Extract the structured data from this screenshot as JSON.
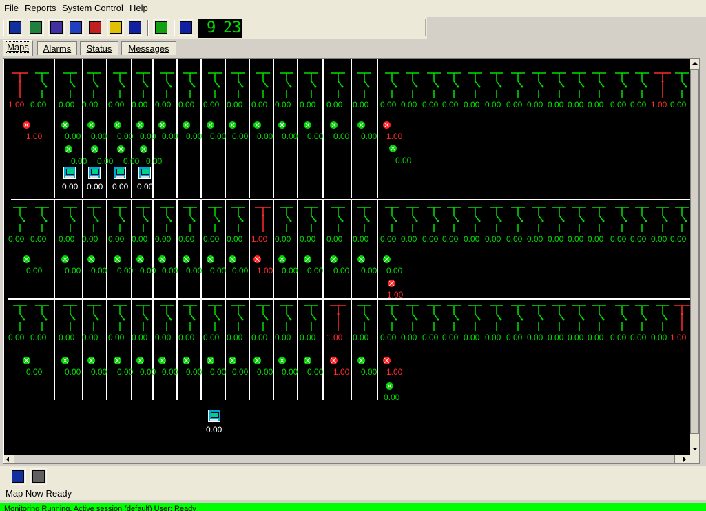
{
  "menu": [
    {
      "label": "File"
    },
    {
      "label": "Reports"
    },
    {
      "label": "System Control"
    },
    {
      "label": "Help"
    }
  ],
  "toolbar": {
    "buttons": [
      {
        "icon": "report-icon",
        "color": "#1030a0"
      },
      {
        "icon": "export-icon",
        "color": "#208040"
      },
      {
        "icon": "edit-icon",
        "color": "#4030a0"
      },
      {
        "icon": "transfer-icon",
        "color": "#2040c0"
      },
      {
        "icon": "tag-red-icon",
        "color": "#c02020"
      },
      {
        "icon": "tag-yellow-icon",
        "color": "#e0c000"
      },
      {
        "icon": "pause-icon",
        "color": "#1020a0"
      },
      {
        "icon": "check-icon",
        "color": "#10a010"
      },
      {
        "icon": "help-icon",
        "color": "#1020a0"
      }
    ],
    "clock_hour": "9",
    "clock_minute": "23"
  },
  "tabs": [
    {
      "label": "Maps",
      "active": true
    },
    {
      "label": "Alarms",
      "active": false
    },
    {
      "label": "Status",
      "active": false
    },
    {
      "label": "Messages",
      "active": false
    }
  ],
  "map": {
    "rows": [
      {
        "switch_values": [
          "1.00",
          "0.00",
          "0.00",
          "0.00",
          "0.00",
          "0.00",
          "0.00",
          "0.00",
          "0.00",
          "0.00",
          "0.00",
          "0.00",
          "0.00",
          "0.00",
          "0.00",
          "0.00",
          "0.00",
          "0.00",
          "0.00",
          "0.00",
          "0.00",
          "0.00",
          "0.00",
          "0.00",
          "0.00",
          "0.00",
          "0.00",
          "0.00",
          "1.00",
          "0.00",
          "0.00"
        ],
        "switch_states": [
          "r",
          "g",
          "g",
          "g",
          "g",
          "g",
          "g",
          "g",
          "g",
          "g",
          "g",
          "g",
          "g",
          "g",
          "g",
          "g",
          "g",
          "g",
          "g",
          "g",
          "g",
          "g",
          "g",
          "g",
          "g",
          "g",
          "g",
          "g",
          "r",
          "g",
          "g"
        ],
        "nodes": [
          {
            "state": "r",
            "value": "1.00"
          },
          {
            "state": "g",
            "value": "0.00"
          },
          {
            "state": "g",
            "value": "0.00"
          },
          {
            "state": "g",
            "value": "0.00"
          },
          {
            "state": "g",
            "value": "0.00"
          },
          {
            "state": "g",
            "value": "0.00"
          },
          {
            "state": "g",
            "value": "0.00"
          },
          {
            "state": "g",
            "value": "0.00"
          },
          {
            "state": "g",
            "value": "0.00"
          },
          {
            "state": "g",
            "value": "0.00"
          },
          {
            "state": "g",
            "value": "0.00"
          },
          {
            "state": "g",
            "value": "0.00"
          },
          {
            "state": "g",
            "value": "0.00"
          },
          {
            "state": "g",
            "value": "0.00"
          },
          {
            "state": "r",
            "value": "1.00"
          }
        ],
        "nodes2": [
          {
            "state": "g",
            "value": "0.00"
          },
          {
            "state": "g",
            "value": "0.00"
          },
          {
            "state": "g",
            "value": "0.00"
          },
          {
            "state": "g",
            "value": "0.00"
          },
          {
            "state": "g",
            "value": "0.00"
          }
        ],
        "computers": [
          "0.00",
          "0.00",
          "0.00",
          "0.00"
        ]
      },
      {
        "switch_values": [
          "0.00",
          "0.00",
          "0.00",
          "0.00",
          "0.00",
          "0.00",
          "0.00",
          "0.00",
          "0.00",
          "0.00",
          "1.00",
          "0.00",
          "0.00",
          "0.00",
          "0.00",
          "0.00",
          "0.00",
          "0.00",
          "0.00",
          "0.00",
          "0.00",
          "0.00",
          "0.00",
          "0.00",
          "0.00",
          "0.00",
          "0.00",
          "0.00",
          "0.00",
          "0.00",
          "0.00"
        ],
        "switch_states": [
          "g",
          "g",
          "g",
          "g",
          "g",
          "g",
          "g",
          "g",
          "g",
          "g",
          "r",
          "g",
          "g",
          "g",
          "g",
          "g",
          "g",
          "g",
          "g",
          "g",
          "g",
          "g",
          "g",
          "g",
          "g",
          "g",
          "g",
          "g",
          "g",
          "g",
          "g"
        ],
        "nodes": [
          {
            "state": "g",
            "value": "0.00"
          },
          {
            "state": "g",
            "value": "0.00"
          },
          {
            "state": "g",
            "value": "0.00"
          },
          {
            "state": "g",
            "value": "0.00"
          },
          {
            "state": "g",
            "value": "0.00"
          },
          {
            "state": "g",
            "value": "0.00"
          },
          {
            "state": "g",
            "value": "0.00"
          },
          {
            "state": "g",
            "value": "0.00"
          },
          {
            "state": "g",
            "value": "0.00"
          },
          {
            "state": "r",
            "value": "1.00"
          },
          {
            "state": "g",
            "value": "0.00"
          },
          {
            "state": "g",
            "value": "0.00"
          },
          {
            "state": "g",
            "value": "0.00"
          },
          {
            "state": "g",
            "value": "0.00"
          },
          {
            "state": "g",
            "value": "0.00"
          }
        ],
        "nodes2": [
          {
            "state": "r",
            "value": "1.00"
          }
        ]
      },
      {
        "switch_values": [
          "0.00",
          "0.00",
          "0.00",
          "0.00",
          "0.00",
          "0.00",
          "0.00",
          "0.00",
          "0.00",
          "0.00",
          "0.00",
          "0.00",
          "0.00",
          "1.00",
          "0.00",
          "0.00",
          "0.00",
          "0.00",
          "0.00",
          "0.00",
          "0.00",
          "0.00",
          "0.00",
          "0.00",
          "0.00",
          "0.00",
          "0.00",
          "0.00",
          "0.00",
          "1.00",
          "0.00"
        ],
        "switch_states": [
          "g",
          "g",
          "g",
          "g",
          "g",
          "g",
          "g",
          "g",
          "g",
          "g",
          "g",
          "g",
          "g",
          "r",
          "g",
          "g",
          "g",
          "g",
          "g",
          "g",
          "g",
          "g",
          "g",
          "g",
          "g",
          "g",
          "g",
          "g",
          "g",
          "r",
          "g"
        ],
        "nodes": [
          {
            "state": "g",
            "value": "0.00"
          },
          {
            "state": "g",
            "value": "0.00"
          },
          {
            "state": "g",
            "value": "0.00"
          },
          {
            "state": "g",
            "value": "0.00"
          },
          {
            "state": "g",
            "value": "0.00"
          },
          {
            "state": "g",
            "value": "0.00"
          },
          {
            "state": "g",
            "value": "0.00"
          },
          {
            "state": "g",
            "value": "0.00"
          },
          {
            "state": "g",
            "value": "0.00"
          },
          {
            "state": "g",
            "value": "0.00"
          },
          {
            "state": "g",
            "value": "0.00"
          },
          {
            "state": "g",
            "value": "0.00"
          },
          {
            "state": "r",
            "value": "1.00"
          },
          {
            "state": "g",
            "value": "0.00"
          },
          {
            "state": "r",
            "value": "1.00"
          }
        ],
        "nodes2": [
          {
            "state": "g",
            "value": "0.00"
          }
        ],
        "computers": [
          "0.00"
        ]
      }
    ]
  },
  "bottom": {
    "buttons": [
      {
        "icon": "book-exit-icon",
        "color": "#1030a0"
      },
      {
        "icon": "print-icon",
        "color": "#606060"
      }
    ],
    "status_message": "Map Now Ready",
    "statusbar_text": "Monitoring Running.  Active session (default)  User: Ready"
  }
}
